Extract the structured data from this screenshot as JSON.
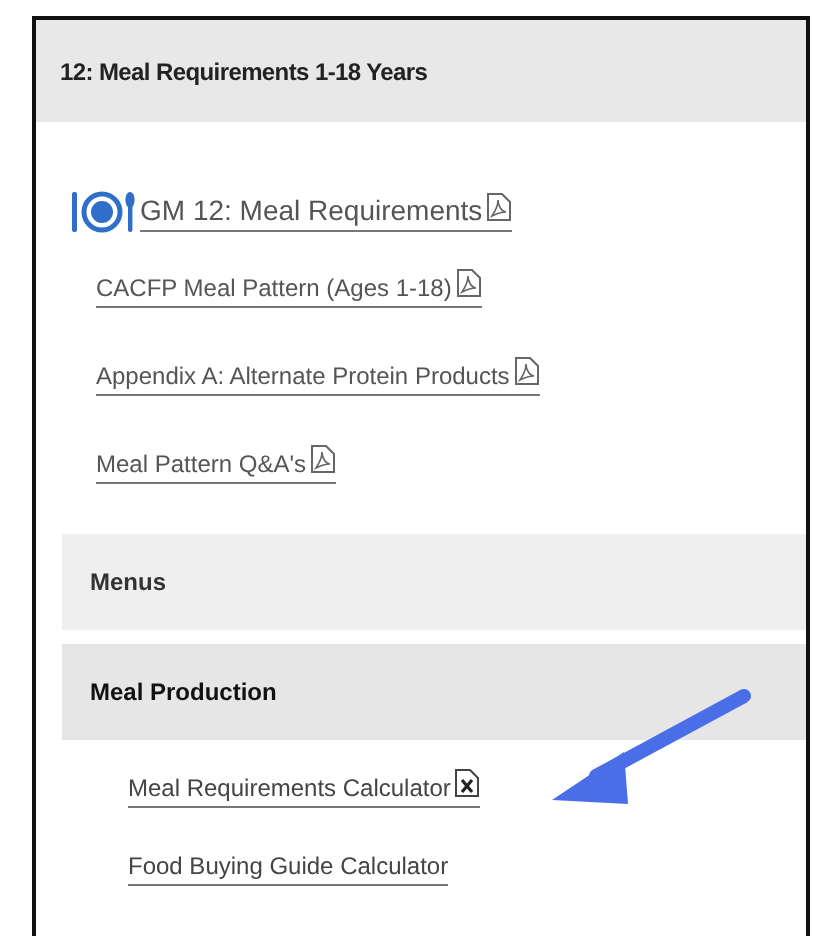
{
  "panel": {
    "title": "12: Meal Requirements 1-18 Years",
    "main_link": {
      "label": "GM 12: Meal Requirements",
      "kind": "pdf"
    },
    "links": [
      {
        "label": "CACFP Meal Pattern (Ages 1-18)",
        "kind": "pdf"
      },
      {
        "label": "Appendix A: Alternate Protein Products",
        "kind": "pdf"
      },
      {
        "label": "Meal Pattern Q&A's",
        "kind": "pdf"
      }
    ],
    "sections": [
      {
        "title": "Menus",
        "expanded": false
      },
      {
        "title": "Meal Production",
        "expanded": true,
        "links": [
          {
            "label": "Meal Requirements Calculator",
            "kind": "xls"
          },
          {
            "label": "Food Buying Guide Calculator",
            "kind": "plain"
          }
        ]
      }
    ]
  }
}
